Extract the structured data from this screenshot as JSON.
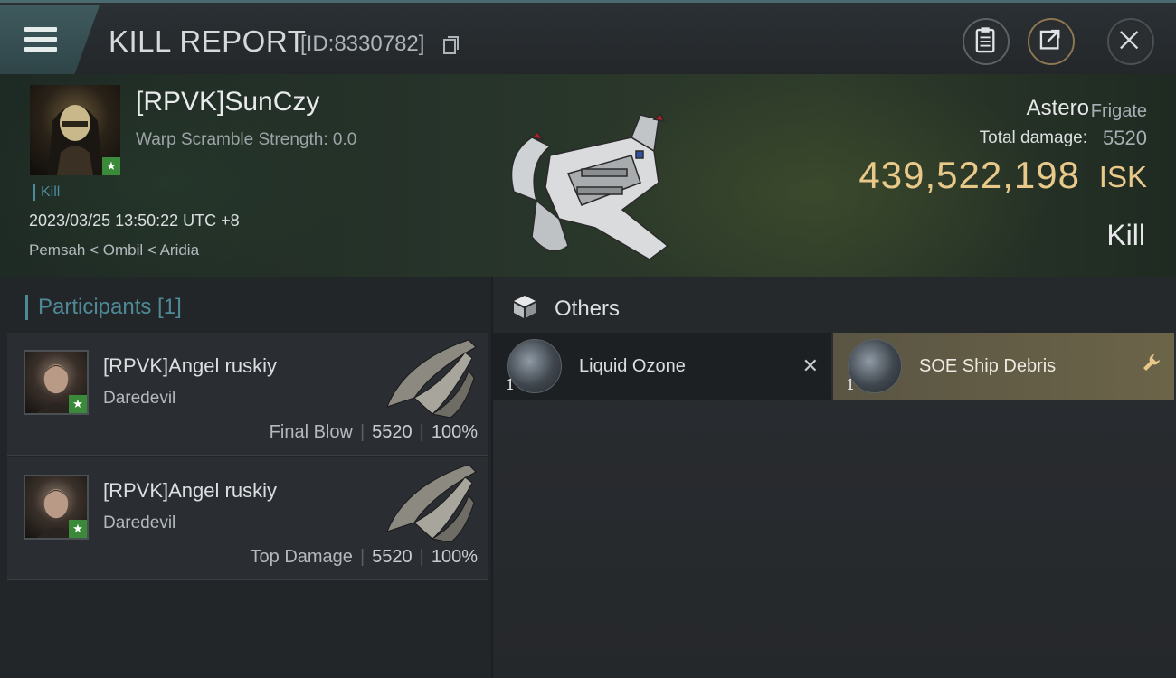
{
  "header": {
    "title": "KILL REPORT",
    "report_id": "[ID:8330782]"
  },
  "victim": {
    "name": "[RPVK]SunCzy",
    "warp_scramble": "Warp Scramble Strength: 0.0",
    "tag": "Kill",
    "datetime": "2023/03/25 13:50:22 UTC +8",
    "location": "Pemsah < Ombil < Aridia",
    "ship_name": "Astero",
    "ship_class": "Frigate",
    "total_damage_label": "Total damage:",
    "total_damage": "5520",
    "isk_value": "439,522,198",
    "isk_unit": "ISK",
    "result": "Kill"
  },
  "participants": {
    "header": "Participants [1]",
    "rows": [
      {
        "name": "[RPVK]Angel ruskiy",
        "ship": "Daredevil",
        "label": "Final Blow",
        "damage": "5520",
        "percent": "100%"
      },
      {
        "name": "[RPVK]Angel ruskiy",
        "ship": "Daredevil",
        "label": "Top Damage",
        "damage": "5520",
        "percent": "100%"
      }
    ]
  },
  "others": {
    "title": "Others",
    "items": [
      {
        "qty": "1",
        "name": "Liquid Ozone",
        "status": "destroyed"
      },
      {
        "qty": "1",
        "name": "SOE Ship Debris",
        "status": "dropped"
      }
    ]
  },
  "colors": {
    "isk_gold": "#e8c98a",
    "accent_teal": "#4e8a96",
    "badge_green": "#3a8a3a",
    "dropped_item_bg": "#6b6449"
  },
  "icons": [
    "menu-icon",
    "copy-icon",
    "clipboard-icon",
    "share-icon",
    "close-icon",
    "star-icon",
    "box-icon",
    "x-icon",
    "wrench-icon"
  ]
}
